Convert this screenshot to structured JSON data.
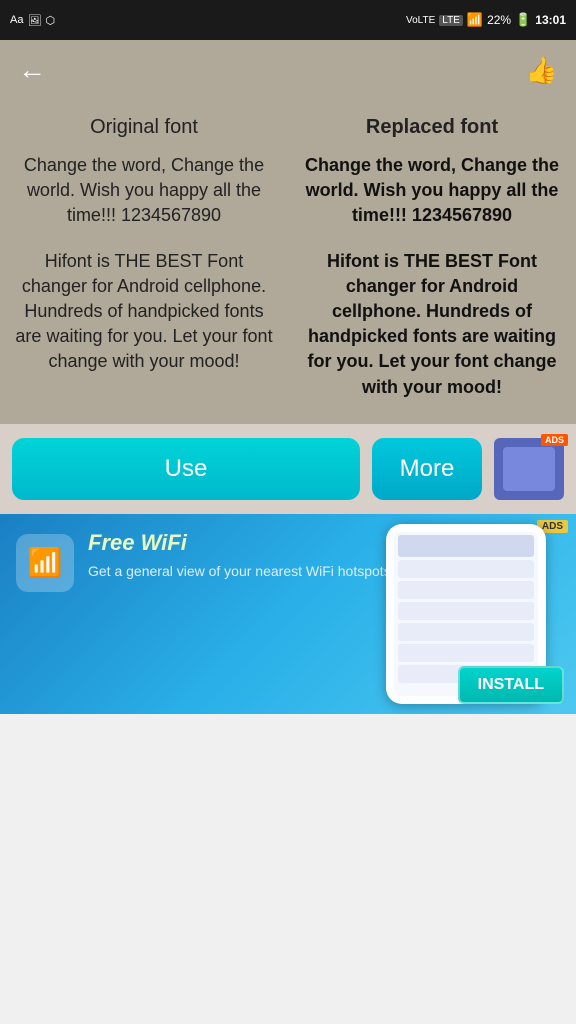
{
  "statusBar": {
    "leftIcons": [
      "Aa",
      "image",
      "usb"
    ],
    "network": "VoLTE",
    "lte": "LTE",
    "signal1": "1",
    "signal2": "↑↓",
    "battery": "22%",
    "time": "13:01"
  },
  "topBar": {
    "backArrow": "←",
    "likeIcon": "👍"
  },
  "preview": {
    "originalHeader": "Original font",
    "replacedHeader": "Replaced font",
    "sampleText1": "Change the word, Change the world. Wish you happy all the time!!! 1234567890",
    "sampleText2": "Hifont is THE BEST Font changer for Android cellphone. Hundreds of handpicked fonts are waiting for you. Let your font change with your mood!"
  },
  "buttons": {
    "use": "Use",
    "more": "More",
    "adsBadge": "ADS"
  },
  "adBanner": {
    "adsBadge": "ADS",
    "title": "Free WiFi",
    "subtitle": "Get a general view of your nearest WiFi hotspots",
    "installLabel": "INSTALL"
  }
}
